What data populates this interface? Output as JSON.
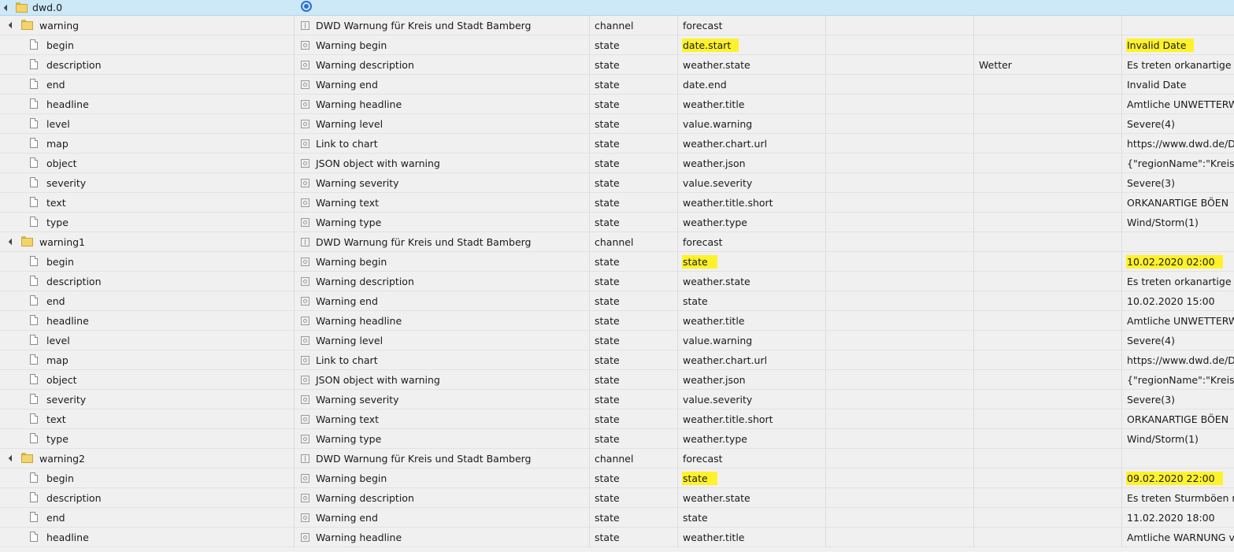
{
  "root": {
    "id": "dwd.0",
    "icon": "adapter-logo-icon"
  },
  "channels": [
    {
      "id": "warning",
      "name": "DWD Warnung für Kreis und Stadt Bamberg",
      "type": "channel",
      "role": "forecast",
      "states": [
        {
          "id": "begin",
          "name": "Warning begin",
          "type": "state",
          "role": "date.start",
          "room": "",
          "func": "",
          "value": "Invalid Date",
          "hl_role": true,
          "hl_value": true
        },
        {
          "id": "description",
          "name": "Warning description",
          "type": "state",
          "role": "weather.state",
          "room": "",
          "func": "Wetter",
          "value": "Es treten orkanartige Bö"
        },
        {
          "id": "end",
          "name": "Warning end",
          "type": "state",
          "role": "date.end",
          "room": "",
          "func": "",
          "value": "Invalid Date"
        },
        {
          "id": "headline",
          "name": "Warning headline",
          "type": "state",
          "role": "weather.title",
          "room": "",
          "func": "",
          "value": "Amtliche UNWETTERWA"
        },
        {
          "id": "level",
          "name": "Warning level",
          "type": "state",
          "role": "value.warning",
          "room": "",
          "func": "",
          "value": "Severe(4)"
        },
        {
          "id": "map",
          "name": "Link to chart",
          "type": "state",
          "role": "weather.chart.url",
          "room": "",
          "func": "",
          "value": "https://www.dwd.de/DV"
        },
        {
          "id": "object",
          "name": "JSON object with warning",
          "type": "state",
          "role": "weather.json",
          "room": "",
          "func": "",
          "value": "{\"regionName\":\"Kreis u"
        },
        {
          "id": "severity",
          "name": "Warning severity",
          "type": "state",
          "role": "value.severity",
          "room": "",
          "func": "",
          "value": "Severe(3)"
        },
        {
          "id": "text",
          "name": "Warning text",
          "type": "state",
          "role": "weather.title.short",
          "room": "",
          "func": "",
          "value": "ORKANARTIGE BÖEN"
        },
        {
          "id": "type",
          "name": "Warning type",
          "type": "state",
          "role": "weather.type",
          "room": "",
          "func": "",
          "value": "Wind/Storm(1)"
        }
      ]
    },
    {
      "id": "warning1",
      "name": "DWD Warnung für Kreis und Stadt Bamberg",
      "type": "channel",
      "role": "forecast",
      "states": [
        {
          "id": "begin",
          "name": "Warning begin",
          "type": "state",
          "role": "state",
          "room": "",
          "func": "",
          "value": "10.02.2020 02:00",
          "hl_role": true,
          "hl_value": true
        },
        {
          "id": "description",
          "name": "Warning description",
          "type": "state",
          "role": "weather.state",
          "room": "",
          "func": "",
          "value": "Es treten orkanartige Bö"
        },
        {
          "id": "end",
          "name": "Warning end",
          "type": "state",
          "role": "state",
          "room": "",
          "func": "",
          "value": "10.02.2020 15:00"
        },
        {
          "id": "headline",
          "name": "Warning headline",
          "type": "state",
          "role": "weather.title",
          "room": "",
          "func": "",
          "value": "Amtliche UNWETTERWA"
        },
        {
          "id": "level",
          "name": "Warning level",
          "type": "state",
          "role": "value.warning",
          "room": "",
          "func": "",
          "value": "Severe(4)"
        },
        {
          "id": "map",
          "name": "Link to chart",
          "type": "state",
          "role": "weather.chart.url",
          "room": "",
          "func": "",
          "value": "https://www.dwd.de/DV"
        },
        {
          "id": "object",
          "name": "JSON object with warning",
          "type": "state",
          "role": "weather.json",
          "room": "",
          "func": "",
          "value": "{\"regionName\":\"Kreis u"
        },
        {
          "id": "severity",
          "name": "Warning severity",
          "type": "state",
          "role": "value.severity",
          "room": "",
          "func": "",
          "value": "Severe(3)"
        },
        {
          "id": "text",
          "name": "Warning text",
          "type": "state",
          "role": "weather.title.short",
          "room": "",
          "func": "",
          "value": "ORKANARTIGE BÖEN"
        },
        {
          "id": "type",
          "name": "Warning type",
          "type": "state",
          "role": "weather.type",
          "room": "",
          "func": "",
          "value": "Wind/Storm(1)"
        }
      ]
    },
    {
      "id": "warning2",
      "name": "DWD Warnung für Kreis und Stadt Bamberg",
      "type": "channel",
      "role": "forecast",
      "states": [
        {
          "id": "begin",
          "name": "Warning begin",
          "type": "state",
          "role": "state",
          "room": "",
          "func": "",
          "value": "09.02.2020 22:00",
          "hl_role": true,
          "hl_value": true
        },
        {
          "id": "description",
          "name": "Warning description",
          "type": "state",
          "role": "weather.state",
          "room": "",
          "func": "",
          "value": "Es treten Sturmböen mi"
        },
        {
          "id": "end",
          "name": "Warning end",
          "type": "state",
          "role": "state",
          "room": "",
          "func": "",
          "value": "11.02.2020 18:00"
        },
        {
          "id": "headline",
          "name": "Warning headline",
          "type": "state",
          "role": "weather.title",
          "room": "",
          "func": "",
          "value": "Amtliche WARNUNG vo"
        }
      ]
    }
  ],
  "colors": {
    "highlight": "#fff22a",
    "root_row": "#cde8f7",
    "background": "#f0f0f0"
  }
}
